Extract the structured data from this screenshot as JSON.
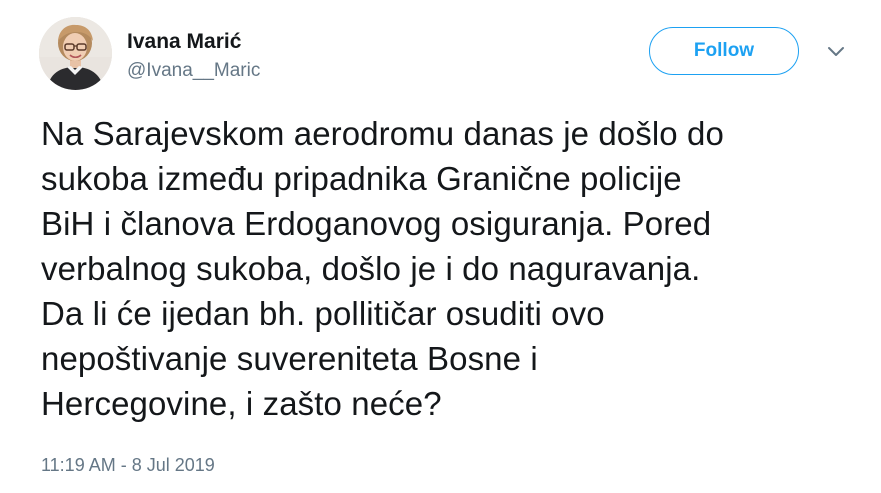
{
  "author": {
    "display_name": "Ivana Marić",
    "handle": "@Ivana__Maric",
    "avatar_icon": "user-avatar-photo"
  },
  "actions": {
    "follow_label": "Follow",
    "more_icon": "chevron-down-icon",
    "accent_color": "#1da1f2"
  },
  "tweet": {
    "text": "Na Sarajevskom aerodromu danas je došlo do\nsukoba između pripadnika Granične policije\nBiH i članova Erdoganovog osiguranja. Pored\nverbalnog sukoba, došlo je i do naguravanja.\nDa li će ijedan bh. pollitičar osuditi ovo\nnepoštivanje suvereniteta Bosne i\nHercegovine, i zašto neće?",
    "timestamp": "11:19 AM - 8 Jul 2019"
  },
  "colors": {
    "text_primary": "#14171a",
    "text_secondary": "#657786"
  }
}
